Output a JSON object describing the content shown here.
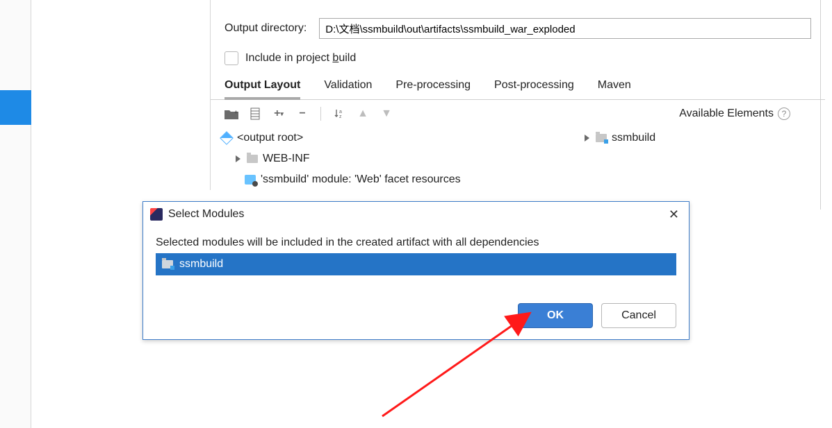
{
  "outdir": {
    "label": "Output directory:",
    "value": "D:\\文档\\ssmbuild\\out\\artifacts\\ssmbuild_war_exploded"
  },
  "include": {
    "label_pre": "Include in project ",
    "label_u": "b",
    "label_post": "uild"
  },
  "tabs": {
    "items": [
      "Output Layout",
      "Validation",
      "Pre-processing",
      "Post-processing",
      "Maven"
    ],
    "active": 0
  },
  "available": {
    "label": "Available Elements",
    "item": "ssmbuild"
  },
  "tree": {
    "root": "<output root>",
    "child1": "WEB-INF",
    "child2": "'ssmbuild' module: 'Web' facet resources"
  },
  "dialog": {
    "title": "Select Modules",
    "desc": "Selected modules will be included in the created artifact with all dependencies",
    "module": "ssmbuild",
    "ok": "OK",
    "cancel": "Cancel"
  }
}
